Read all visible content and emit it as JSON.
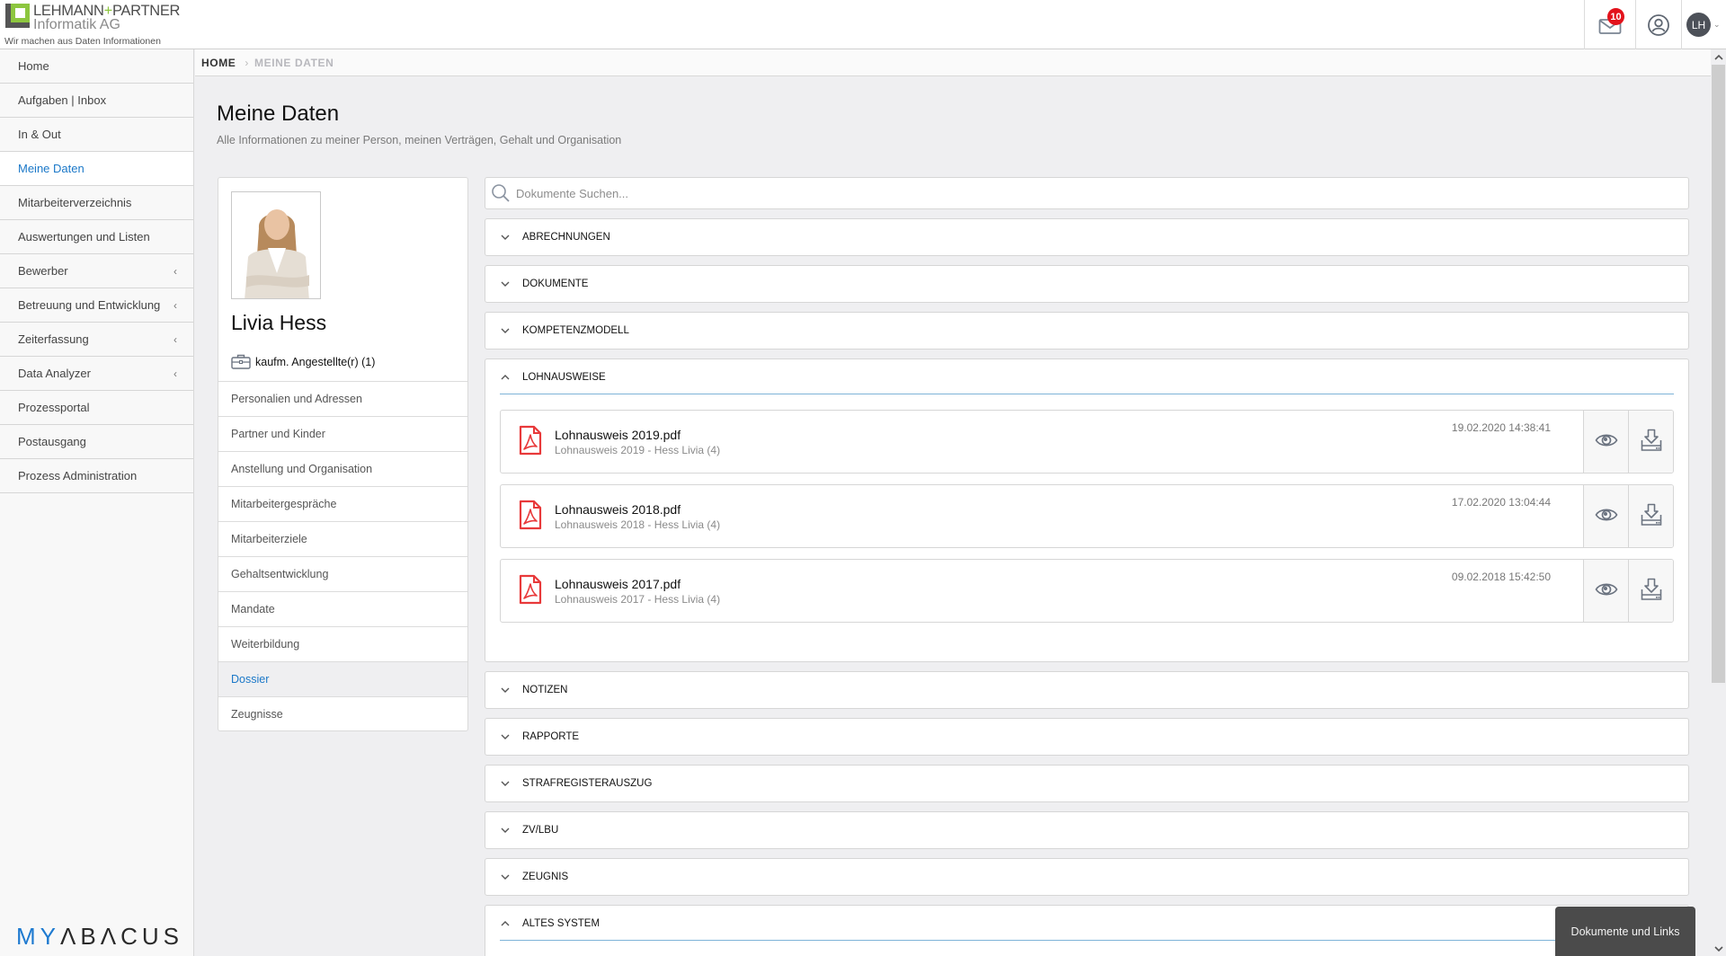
{
  "header": {
    "logo": {
      "line1_a": "LEHMANN",
      "line1_plus": "+",
      "line1_b": "PARTNER",
      "line2": "Informatik AG",
      "tagline": "Wir machen aus Daten Informationen"
    },
    "notifications_count": "10",
    "user_initials": "LH"
  },
  "sidebar": {
    "items": [
      {
        "label": "Home",
        "active": false,
        "expandable": false
      },
      {
        "label": "Aufgaben | Inbox",
        "active": false,
        "expandable": false
      },
      {
        "label": "In & Out",
        "active": false,
        "expandable": false
      },
      {
        "label": "Meine Daten",
        "active": true,
        "expandable": false
      },
      {
        "label": "Mitarbeiterverzeichnis",
        "active": false,
        "expandable": false
      },
      {
        "label": "Auswertungen und Listen",
        "active": false,
        "expandable": false
      },
      {
        "label": "Bewerber",
        "active": false,
        "expandable": true
      },
      {
        "label": "Betreuung und Entwicklung",
        "active": false,
        "expandable": true
      },
      {
        "label": "Zeiterfassung",
        "active": false,
        "expandable": true
      },
      {
        "label": "Data Analyzer",
        "active": false,
        "expandable": true
      },
      {
        "label": "Prozessportal",
        "active": false,
        "expandable": false
      },
      {
        "label": "Postausgang",
        "active": false,
        "expandable": false
      },
      {
        "label": "Prozess Administration",
        "active": false,
        "expandable": false
      }
    ],
    "chevron": "‹",
    "brand_my": "MY",
    "brand_rest": "ΛBΛCUS"
  },
  "breadcrumb": {
    "home": "HOME",
    "separator": "›",
    "current": "MEINE DATEN"
  },
  "page": {
    "title": "Meine Daten",
    "subtitle": "Alle Informationen zu meiner Person, meinen Verträgen, Gehalt und Organisation"
  },
  "profile": {
    "name": "Livia Hess",
    "role": "kaufm. Angestellte(r) (1)",
    "menu": [
      {
        "label": "Personalien und Adressen",
        "active": false
      },
      {
        "label": "Partner und Kinder",
        "active": false
      },
      {
        "label": "Anstellung und Organisation",
        "active": false
      },
      {
        "label": "Mitarbeitergespräche",
        "active": false
      },
      {
        "label": "Mitarbeiterziele",
        "active": false
      },
      {
        "label": "Gehaltsentwicklung",
        "active": false
      },
      {
        "label": "Mandate",
        "active": false
      },
      {
        "label": "Weiterbildung",
        "active": false
      },
      {
        "label": "Dossier",
        "active": true
      },
      {
        "label": "Zeugnisse",
        "active": false
      }
    ]
  },
  "documents": {
    "search_placeholder": "Dokumente Suchen...",
    "sections": [
      {
        "label": "ABRECHNUNGEN",
        "expanded": false
      },
      {
        "label": "DOKUMENTE",
        "expanded": false
      },
      {
        "label": "KOMPETENZMODELL",
        "expanded": false
      },
      {
        "label": "LOHNAUSWEISE",
        "expanded": true
      },
      {
        "label": "NOTIZEN",
        "expanded": false
      },
      {
        "label": "RAPPORTE",
        "expanded": false
      },
      {
        "label": "STRAFREGISTERAUSZUG",
        "expanded": false
      },
      {
        "label": "ZV/LBU",
        "expanded": false
      },
      {
        "label": "ZEUGNIS",
        "expanded": false
      },
      {
        "label": "ALTES SYSTEM",
        "expanded": true
      }
    ],
    "files": [
      {
        "name": "Lohnausweis 2019.pdf",
        "description": "Lohnausweis 2019 - Hess Livia (4)",
        "date": "19.02.2020 14:38:41"
      },
      {
        "name": "Lohnausweis 2018.pdf",
        "description": "Lohnausweis 2018 - Hess Livia (4)",
        "date": "17.02.2020 13:04:44"
      },
      {
        "name": "Lohnausweis 2017.pdf",
        "description": "Lohnausweis 2017 - Hess Livia (4)",
        "date": "09.02.2018 15:42:50"
      }
    ]
  },
  "tooltip": {
    "label": "Dokumente und Links"
  },
  "colors": {
    "accent": "#1b78c8",
    "badge": "#e3121b",
    "pdf": "#e8393a",
    "logo_green": "#8dc63f"
  }
}
